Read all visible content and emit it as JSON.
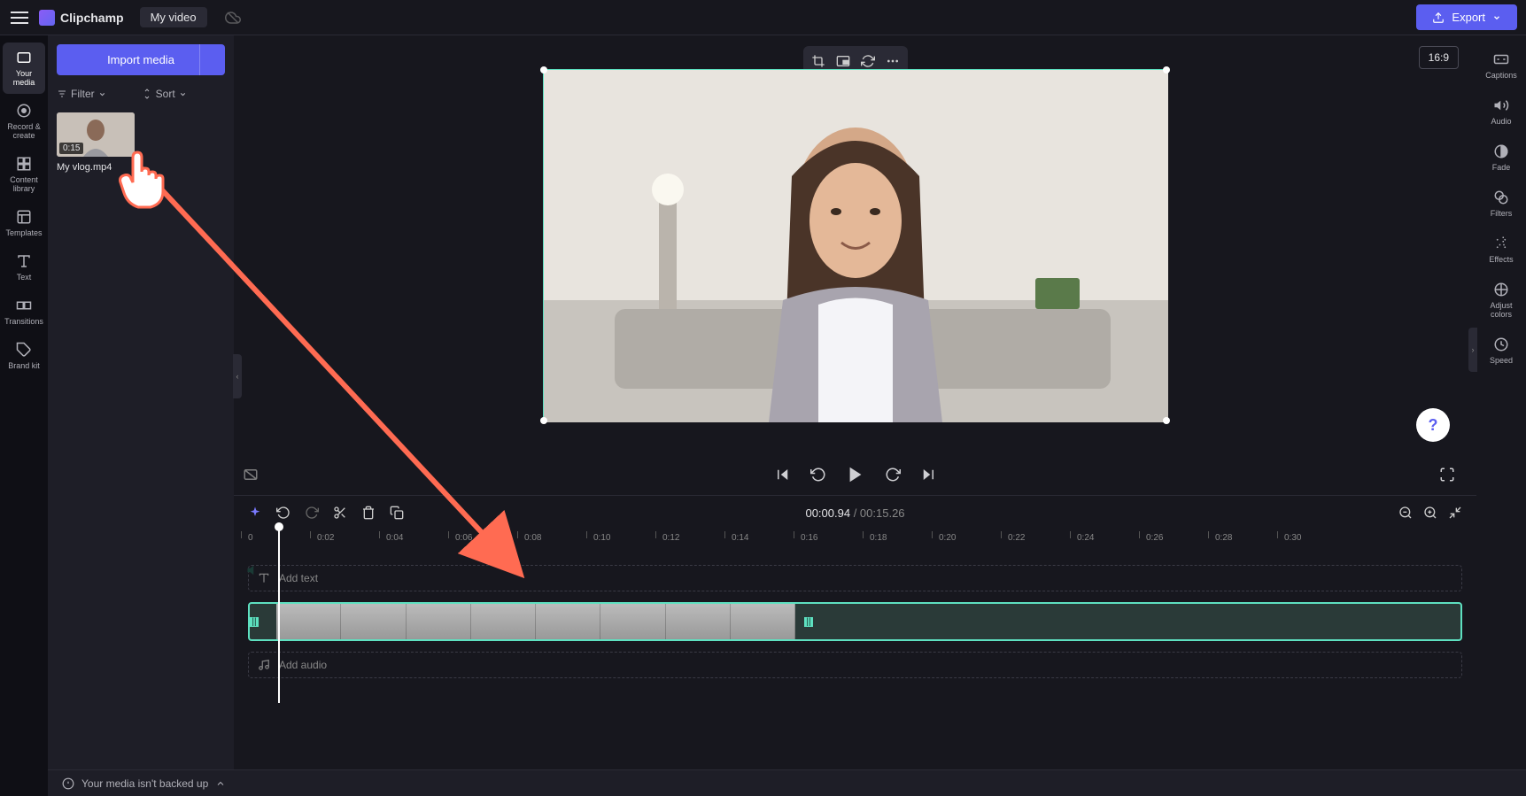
{
  "app": {
    "name": "Clipchamp",
    "video_title": "My video"
  },
  "export_label": "Export",
  "aspect_ratio": "16:9",
  "left_rail": [
    {
      "label": "Your media",
      "icon": "media"
    },
    {
      "label": "Record & create",
      "icon": "record"
    },
    {
      "label": "Content library",
      "icon": "library"
    },
    {
      "label": "Templates",
      "icon": "templates"
    },
    {
      "label": "Text",
      "icon": "text"
    },
    {
      "label": "Transitions",
      "icon": "transitions"
    },
    {
      "label": "Brand kit",
      "icon": "brand"
    }
  ],
  "media_panel": {
    "import_label": "Import media",
    "filter_label": "Filter",
    "sort_label": "Sort",
    "item": {
      "duration": "0:15",
      "name": "My vlog.mp4"
    }
  },
  "right_rail": [
    {
      "label": "Captions"
    },
    {
      "label": "Audio"
    },
    {
      "label": "Fade"
    },
    {
      "label": "Filters"
    },
    {
      "label": "Effects"
    },
    {
      "label": "Adjust colors"
    },
    {
      "label": "Speed"
    }
  ],
  "timecode": {
    "current": "00:00.94",
    "total": "00:15.26"
  },
  "ruler": [
    "0",
    "0:02",
    "0:04",
    "0:06",
    "0:08",
    "0:10",
    "0:12",
    "0:14",
    "0:16",
    "0:18",
    "0:20",
    "0:22",
    "0:24",
    "0:26",
    "0:28",
    "0:30"
  ],
  "tracks": {
    "text": "Add text",
    "audio": "Add audio"
  },
  "status": "Your media isn't backed up",
  "help": "?"
}
